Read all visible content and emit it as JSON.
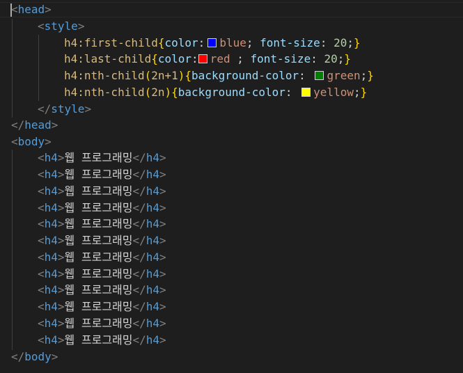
{
  "css_rules": [
    {
      "selector": "h4:first-child",
      "prop1": "color",
      "value1": "blue",
      "sep1": " ",
      "tail_prop": "font-size",
      "tail_val": "20",
      "swatch": "#0000ff"
    },
    {
      "selector": "h4:last-child",
      "prop1": "color",
      "value1": "red",
      "sep1": "",
      "value_suffix": " ",
      "tail_prop": "font-size",
      "tail_val": "20",
      "swatch": "#ff0000"
    },
    {
      "selector": "h4:nth-child(2n+1)",
      "prop1": "background-color",
      "value1": "green",
      "swatch": "#008000"
    },
    {
      "selector": "h4:nth-child(2n)",
      "prop1": "background-color",
      "value1": "yellow",
      "swatch": "#ffff00"
    }
  ],
  "tags": {
    "head": "head",
    "style": "style",
    "body": "body",
    "h4": "h4"
  },
  "h4_text": "웹 프로그래밍",
  "h4_count": 12,
  "colors": {
    "tag": "#569cd6",
    "selector": "#d7ba7d",
    "property": "#9cdcfe",
    "value": "#ce9178",
    "number": "#b5cea8",
    "bracket": "#ffd700",
    "punctuation": "#808080",
    "background": "#1e1e1e"
  }
}
